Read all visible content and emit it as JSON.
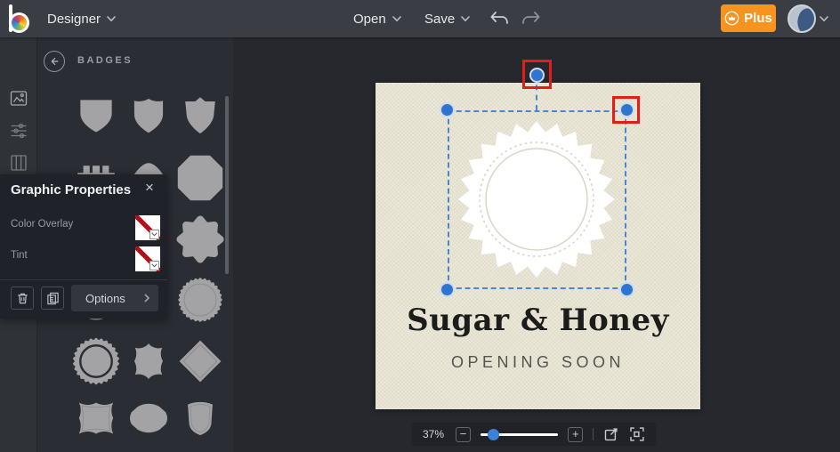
{
  "topbar": {
    "app_label": "Designer",
    "open_label": "Open",
    "save_label": "Save",
    "plus_label": "Plus"
  },
  "badges_panel": {
    "title": "BADGES"
  },
  "properties_panel": {
    "title": "Graphic Properties",
    "close_glyph": "×",
    "color_overlay_label": "Color Overlay",
    "tint_label": "Tint",
    "options_label": "Options"
  },
  "canvas": {
    "title": "Sugar & Honey",
    "subtitle": "OPENING SOON"
  },
  "zoombar": {
    "zoom_level": "37%",
    "minus_glyph": "−",
    "plus_glyph": "+"
  },
  "colors": {
    "accent_blue": "#2f74cf",
    "plus_orange": "#f7931e",
    "annotation_red": "#e41d17",
    "canvas_beige": "#ebe8d9",
    "swatch_stripe_red": "#b0111a"
  },
  "icons": [
    "befunky-logo",
    "chevron-down-icon",
    "undo-icon",
    "redo-icon",
    "crown-icon",
    "avatar",
    "image-icon",
    "adjustments-icon",
    "columns-icon",
    "heart-icon",
    "back-arrow-icon",
    "trash-icon",
    "duplicate-icon",
    "none-swatch",
    "minus-icon",
    "plus-icon",
    "resize-icon",
    "fit-screen-icon"
  ]
}
